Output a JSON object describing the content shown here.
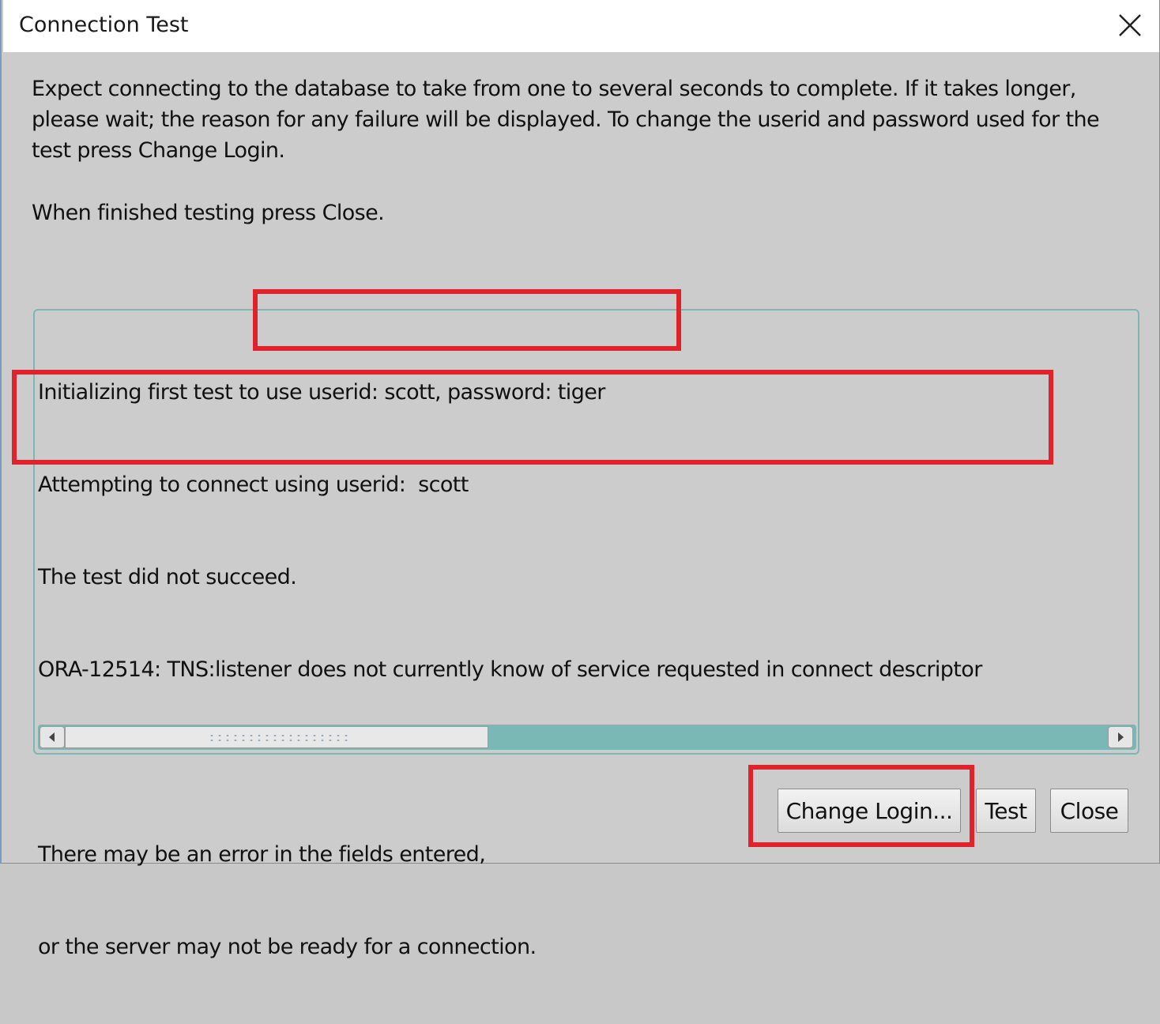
{
  "window": {
    "title": "Connection Test"
  },
  "intro": {
    "line1": "Expect connecting to the database to take from one to several seconds to complete. If it takes longer,",
    "line2": "please wait; the reason for any failure will be displayed. To change the userid and password used for the",
    "line3": "test press Change Login.",
    "finish": "When finished testing press Close."
  },
  "results": {
    "lines": [
      "Initializing first test to use userid: scott, password: tiger",
      "Attempting to connect using userid:  scott",
      "The test did not succeed.",
      "ORA-12514: TNS:listener does not currently know of service requested in connect descriptor",
      "",
      "There may be an error in the fields entered,",
      "or the server may not be ready for a connection."
    ]
  },
  "buttons": {
    "change_login": "Change Login...",
    "test": "Test",
    "close": "Close"
  },
  "colors": {
    "highlight": "#e0222b",
    "scrollbar_track": "#79b8b4",
    "dialog_bg": "#cccccc"
  }
}
